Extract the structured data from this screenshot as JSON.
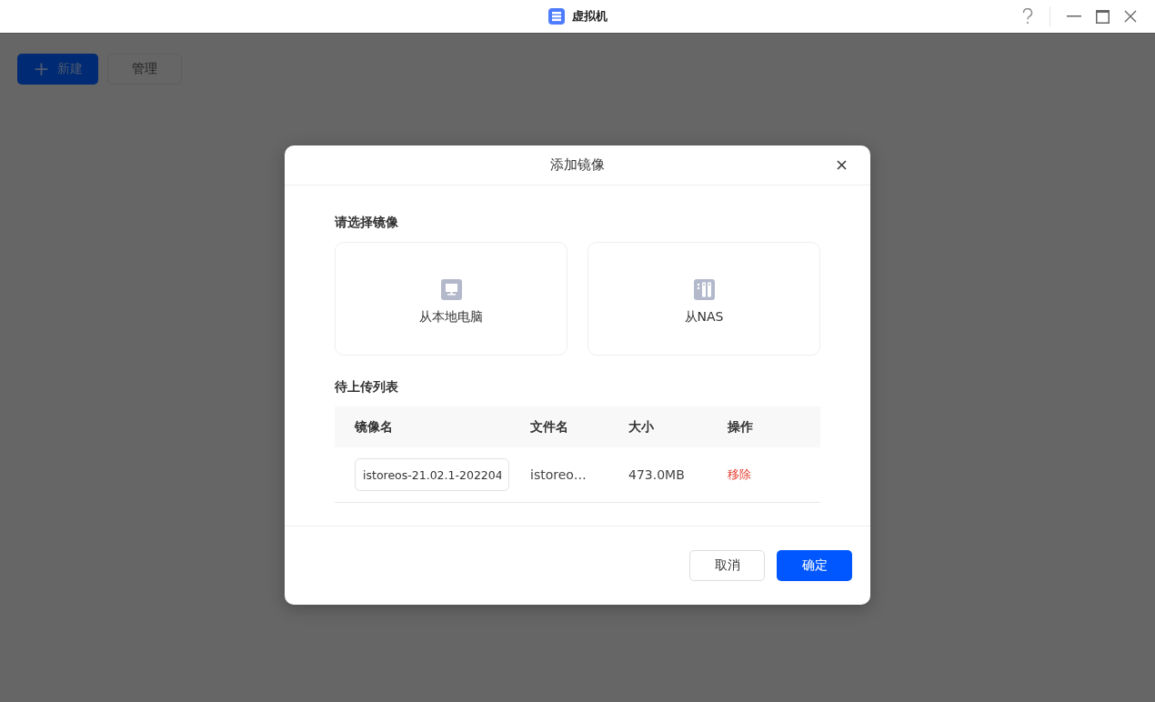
{
  "window": {
    "title": "虚拟机"
  },
  "toolbar": {
    "buttons": [
      {
        "label": "新建",
        "kind": "primary",
        "icon": "+"
      },
      {
        "label": "管理",
        "kind": "default"
      }
    ]
  },
  "dialog": {
    "title": "添加镜像",
    "source_heading": "请选择镜像",
    "sources": [
      {
        "label": "从本地电脑",
        "kind": "computer"
      },
      {
        "label": "从NAS",
        "kind": "nas"
      }
    ],
    "list_heading": "待上传列表",
    "table": {
      "columns": [
        "镜像名",
        "文件名",
        "大小",
        "操作"
      ],
      "rows": [
        {
          "image_name": "istoreos-21.02.1-202204",
          "file_name": "istoreo…",
          "size": "473.0MB",
          "action": "移除"
        }
      ]
    },
    "buttons": [
      {
        "label": "取消",
        "kind": "default"
      },
      {
        "label": "确定",
        "kind": "primary"
      }
    ]
  }
}
